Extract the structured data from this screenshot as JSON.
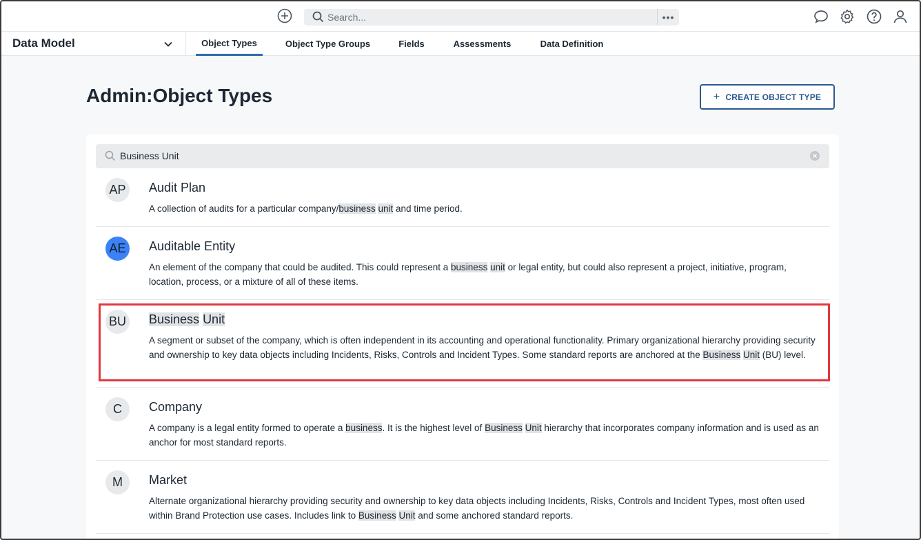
{
  "topbar": {
    "search_placeholder": "Search...",
    "more_label": "•••",
    "icons": [
      "add-circle-icon",
      "search-icon",
      "chat-icon",
      "gear-icon",
      "help-icon",
      "user-icon"
    ]
  },
  "nav": {
    "app_title": "Data Model",
    "tabs": [
      {
        "label": "Object Types",
        "active": true
      },
      {
        "label": "Object Type Groups",
        "active": false
      },
      {
        "label": "Fields",
        "active": false
      },
      {
        "label": "Assessments",
        "active": false
      },
      {
        "label": "Data Definition",
        "active": false
      }
    ]
  },
  "header": {
    "title_prefix": "Admin",
    "title_sep": ":",
    "title_main": "Object Types",
    "create_label": "CREATE OBJECT TYPE"
  },
  "filter": {
    "value": "Business Unit"
  },
  "items": [
    {
      "initials": "AP",
      "name": "Audit Plan",
      "desc_parts": [
        "A collection of audits for a particular company/",
        "business",
        " ",
        "unit",
        " and time period."
      ]
    },
    {
      "initials": "AE",
      "name": "Auditable Entity",
      "desc_parts": [
        "An element of the company that could be audited. This could represent a ",
        "business",
        " ",
        "unit",
        " or legal entity, but could also represent a project, initiative, program, location, process, or a mixture of all of these items."
      ]
    },
    {
      "initials": "BU",
      "name_parts": [
        "Business",
        " ",
        "Unit"
      ],
      "desc_parts": [
        "A segment or subset of the company, which is often independent in its accounting and operational functionality. Primary organizational hierarchy providing security and ownership to key data objects including Incidents, Risks, Controls and Incident Types. Some standard reports are anchored at the ",
        "Business",
        " ",
        "Unit",
        " (BU) level."
      ]
    },
    {
      "initials": "C",
      "name": "Company",
      "desc_parts": [
        "A company is a legal entity formed to operate a ",
        "business",
        ". It is the highest level of ",
        "Business",
        " ",
        "Unit",
        " hierarchy that incorporates company information and is used as an anchor for most standard reports."
      ]
    },
    {
      "initials": "M",
      "name": "Market",
      "desc_parts": [
        "Alternate organizational hierarchy providing security and ownership to key data objects including Incidents, Risks, Controls and Incident Types, most often used within Brand Protection use cases. Includes link to ",
        "Business",
        " ",
        "Unit",
        " and some anchored standard reports."
      ]
    }
  ],
  "colors": {
    "accent": "#2b6cb0",
    "button_border": "#2b5a8f",
    "highlight_box": "#e0383e",
    "avatar_blue": "#3b82f6"
  }
}
